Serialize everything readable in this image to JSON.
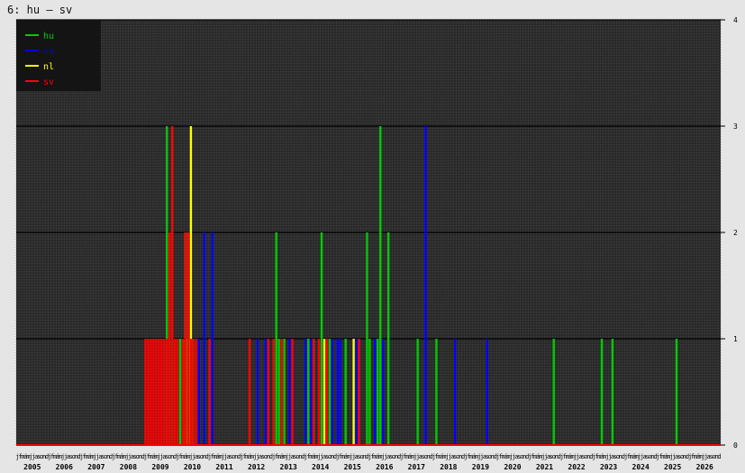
{
  "title": "6: hu – sv",
  "chart_data": {
    "type": "bar",
    "title": "6: hu – sv",
    "xlabel": "",
    "ylabel": "",
    "x_range": [
      "2005-01",
      "2026-12"
    ],
    "ylim": [
      0,
      4
    ],
    "y_ticks": [
      0,
      1,
      2,
      3,
      4
    ],
    "grid": true,
    "legend_position": "top-left",
    "month_labels": [
      "j",
      "f",
      "m",
      "á",
      "m",
      "j",
      "j",
      "a",
      "s",
      "o",
      "n",
      "d"
    ],
    "year_labels": [
      "2005",
      "2006",
      "2007",
      "2008",
      "2009",
      "2010",
      "2011",
      "2012",
      "2013",
      "2014",
      "2015",
      "2016",
      "2017",
      "2018",
      "2019",
      "2020",
      "2021",
      "2022",
      "2023",
      "2024",
      "2025",
      "2026"
    ],
    "series": [
      {
        "name": "hu",
        "color": "#00c800",
        "points": [
          [
            "2009-09",
            3
          ],
          [
            "2009-10",
            1
          ],
          [
            "2009-11",
            1
          ],
          [
            "2010-02",
            1
          ],
          [
            "2010-05",
            1
          ],
          [
            "2010-07",
            1
          ],
          [
            "2013-02",
            2
          ],
          [
            "2013-03",
            1
          ],
          [
            "2013-05",
            1
          ],
          [
            "2014-02",
            1
          ],
          [
            "2014-04",
            1
          ],
          [
            "2014-07",
            2
          ],
          [
            "2014-10",
            1
          ],
          [
            "2015-04",
            1
          ],
          [
            "2015-12",
            2
          ],
          [
            "2016-01",
            1
          ],
          [
            "2016-04",
            1
          ],
          [
            "2016-05",
            3
          ],
          [
            "2016-08",
            2
          ],
          [
            "2017-07",
            1
          ],
          [
            "2018-02",
            1
          ],
          [
            "2021-10",
            1
          ],
          [
            "2023-04",
            1
          ],
          [
            "2023-08",
            1
          ],
          [
            "2025-08",
            1
          ]
        ]
      },
      {
        "name": "cs",
        "color": "#0000ff",
        "points": [
          [
            "2010-09",
            1
          ],
          [
            "2010-11",
            2
          ],
          [
            "2011-02",
            2
          ],
          [
            "2012-07",
            1
          ],
          [
            "2012-10",
            1
          ],
          [
            "2013-07",
            1
          ],
          [
            "2014-01",
            1
          ],
          [
            "2014-03",
            1
          ],
          [
            "2014-09",
            1
          ],
          [
            "2014-11",
            1
          ],
          [
            "2015-01",
            1
          ],
          [
            "2015-02",
            1
          ],
          [
            "2015-08",
            1
          ],
          [
            "2016-03",
            1
          ],
          [
            "2016-06",
            1
          ],
          [
            "2017-10",
            3
          ],
          [
            "2018-09",
            1
          ],
          [
            "2019-09",
            1
          ]
        ]
      },
      {
        "name": "nl",
        "color": "#ffff00",
        "points": [
          [
            "2010-04",
            2
          ],
          [
            "2010-05",
            1
          ],
          [
            "2010-06",
            3
          ],
          [
            "2014-08",
            1
          ],
          [
            "2015-07",
            1
          ]
        ]
      },
      {
        "name": "sv",
        "color": "#ff0000",
        "points": [
          [
            "2009-01",
            1
          ],
          [
            "2009-02",
            1
          ],
          [
            "2009-03",
            1
          ],
          [
            "2009-04",
            1
          ],
          [
            "2009-05",
            1
          ],
          [
            "2009-06",
            1
          ],
          [
            "2009-07",
            1
          ],
          [
            "2009-08",
            1
          ],
          [
            "2009-09",
            1
          ],
          [
            "2009-10",
            2
          ],
          [
            "2009-11",
            3
          ],
          [
            "2009-12",
            1
          ],
          [
            "2010-01",
            1
          ],
          [
            "2010-03",
            1
          ],
          [
            "2010-04",
            2
          ],
          [
            "2010-05",
            2
          ],
          [
            "2010-06",
            1
          ],
          [
            "2010-07",
            1
          ],
          [
            "2010-08",
            1
          ],
          [
            "2011-01",
            1
          ],
          [
            "2012-04",
            1
          ],
          [
            "2012-11",
            1
          ],
          [
            "2013-01",
            1
          ],
          [
            "2013-04",
            1
          ],
          [
            "2013-08",
            1
          ],
          [
            "2014-04",
            1
          ],
          [
            "2014-06",
            1
          ],
          [
            "2014-09",
            1
          ],
          [
            "2015-09",
            1
          ]
        ]
      }
    ]
  }
}
